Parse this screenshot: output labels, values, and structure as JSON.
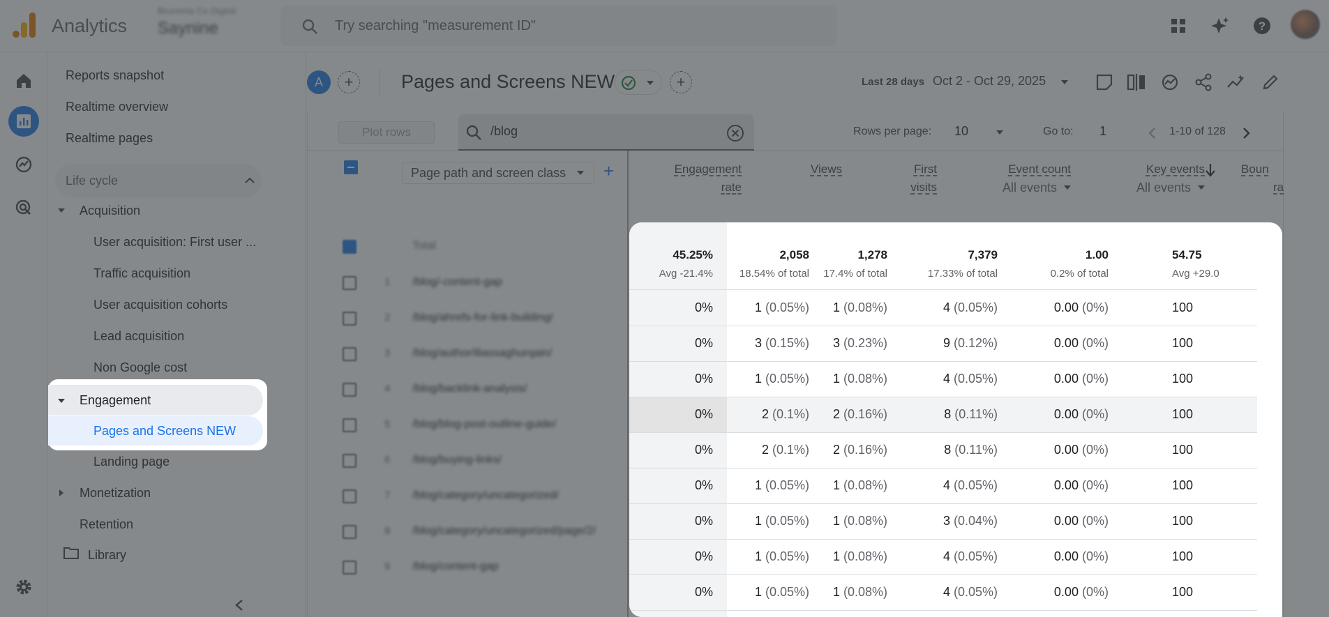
{
  "app": {
    "name": "Analytics"
  },
  "account": {
    "line1": "Brunonia Co Digital",
    "line2": "Saynine"
  },
  "search": {
    "placeholder": "Try searching \"measurement ID\""
  },
  "sidenav": {
    "reports_snapshot": "Reports snapshot",
    "realtime_overview": "Realtime overview",
    "realtime_pages": "Realtime pages",
    "section": "Life cycle",
    "acquisition": "Acquisition",
    "acq_items": [
      "User acquisition: First user ...",
      "Traffic acquisition",
      "User acquisition cohorts",
      "Lead acquisition",
      "Non Google cost"
    ],
    "engagement": "Engagement",
    "pages_and_screens": "Pages and Screens NEW",
    "landing_page": "Landing page",
    "monetization": "Monetization",
    "retention": "Retention",
    "library": "Library"
  },
  "header": {
    "avatar_letter": "A",
    "title": "Pages and Screens NEW",
    "date_label": "Last 28 days",
    "date_range": "Oct 2 - Oct 29, 2025"
  },
  "controls": {
    "plot_rows": "Plot rows",
    "filter_value": "/blog",
    "rows_per_page_label": "Rows per page:",
    "rows_per_page": "10",
    "goto_label": "Go to:",
    "goto_value": "1",
    "page_range": "1-10 of 128"
  },
  "dimension": {
    "label": "Page path and screen class",
    "total_label": "Total"
  },
  "rows_blurred": [
    {
      "n": "1",
      "path": "/blog/-content-gap"
    },
    {
      "n": "2",
      "path": "/blog/ahrefs-for-link-building/"
    },
    {
      "n": "3",
      "path": "/blog/author/iliassaghurqain/"
    },
    {
      "n": "4",
      "path": "/blog/backlink-analysis/"
    },
    {
      "n": "5",
      "path": "/blog/blog-post-outline-guide/"
    },
    {
      "n": "6",
      "path": "/blog/buying-links/"
    },
    {
      "n": "7",
      "path": "/blog/category/uncategorized/"
    },
    {
      "n": "8",
      "path": "/blog/category/uncategorized/page/2/"
    },
    {
      "n": "9",
      "path": "/blog/content-gap"
    }
  ],
  "columns": {
    "engagement_rate": [
      "Engagement",
      "rate"
    ],
    "views": "Views",
    "first_visits": [
      "First",
      "visits"
    ],
    "event_count": "Event count",
    "event_count_sub": "All events",
    "key_events": "Key events",
    "key_events_sub": "All events",
    "bounce": [
      "Boun",
      "ra"
    ]
  },
  "totals": [
    {
      "v": "45.25%",
      "s": "Avg -21.4%"
    },
    {
      "v": "2,058",
      "s": "18.54% of total"
    },
    {
      "v": "1,278",
      "s": "17.4% of total"
    },
    {
      "v": "7,379",
      "s": "17.33% of total"
    },
    {
      "v": "1.00",
      "s": "0.2% of total"
    },
    {
      "v": "54.75",
      "s": "Avg +29.0"
    }
  ],
  "rows": [
    {
      "er": "0%",
      "views": "1",
      "views_p": "(0.05%)",
      "fv": "1",
      "fv_p": "(0.08%)",
      "ec": "4",
      "ec_p": "(0.05%)",
      "ke": "0.00",
      "ke_p": "(0%)",
      "br": "100"
    },
    {
      "er": "0%",
      "views": "3",
      "views_p": "(0.15%)",
      "fv": "3",
      "fv_p": "(0.23%)",
      "ec": "9",
      "ec_p": "(0.12%)",
      "ke": "0.00",
      "ke_p": "(0%)",
      "br": "100"
    },
    {
      "er": "0%",
      "views": "1",
      "views_p": "(0.05%)",
      "fv": "1",
      "fv_p": "(0.08%)",
      "ec": "4",
      "ec_p": "(0.05%)",
      "ke": "0.00",
      "ke_p": "(0%)",
      "br": "100"
    },
    {
      "er": "0%",
      "views": "2",
      "views_p": "(0.1%)",
      "fv": "2",
      "fv_p": "(0.16%)",
      "ec": "8",
      "ec_p": "(0.11%)",
      "ke": "0.00",
      "ke_p": "(0%)",
      "br": "100"
    },
    {
      "er": "0%",
      "views": "2",
      "views_p": "(0.1%)",
      "fv": "2",
      "fv_p": "(0.16%)",
      "ec": "8",
      "ec_p": "(0.11%)",
      "ke": "0.00",
      "ke_p": "(0%)",
      "br": "100"
    },
    {
      "er": "0%",
      "views": "1",
      "views_p": "(0.05%)",
      "fv": "1",
      "fv_p": "(0.08%)",
      "ec": "4",
      "ec_p": "(0.05%)",
      "ke": "0.00",
      "ke_p": "(0%)",
      "br": "100"
    },
    {
      "er": "0%",
      "views": "1",
      "views_p": "(0.05%)",
      "fv": "1",
      "fv_p": "(0.08%)",
      "ec": "3",
      "ec_p": "(0.04%)",
      "ke": "0.00",
      "ke_p": "(0%)",
      "br": "100"
    },
    {
      "er": "0%",
      "views": "1",
      "views_p": "(0.05%)",
      "fv": "1",
      "fv_p": "(0.08%)",
      "ec": "4",
      "ec_p": "(0.05%)",
      "ke": "0.00",
      "ke_p": "(0%)",
      "br": "100"
    },
    {
      "er": "0%",
      "views": "1",
      "views_p": "(0.05%)",
      "fv": "1",
      "fv_p": "(0.08%)",
      "ec": "4",
      "ec_p": "(0.05%)",
      "ke": "0.00",
      "ke_p": "(0%)",
      "br": "100"
    }
  ],
  "colors": {
    "accent": "#1a73e8",
    "overlay": "#3c4043",
    "nav_selected_bg": "#e8f0fe"
  }
}
